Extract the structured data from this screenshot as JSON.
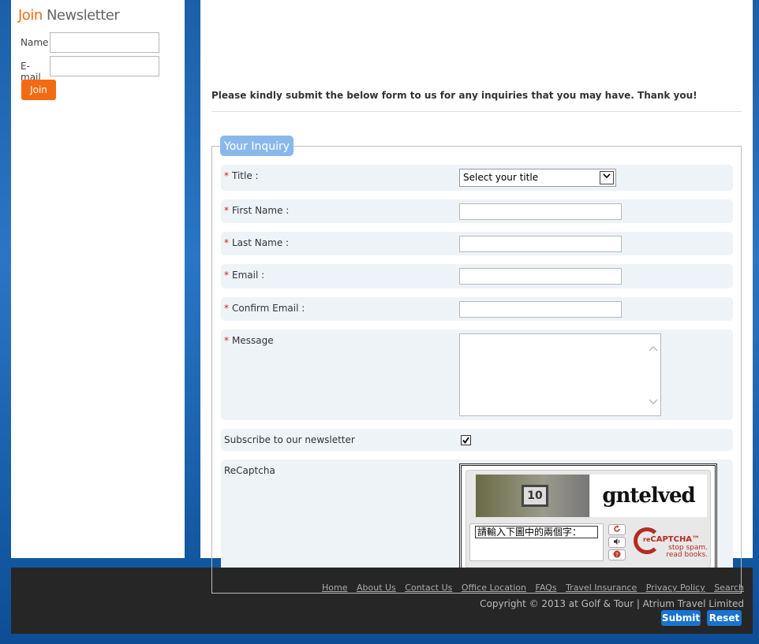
{
  "newsletter": {
    "title_accent": "Join",
    "title_rest": "Newsletter",
    "name_label": "Name",
    "email_label": "E-mail",
    "join_label": "Join"
  },
  "intro": "Please kindly submit the below form to us for any inquiries that you may have. Thank you!",
  "form": {
    "legend": "Your Inquiry",
    "required_mark": "*",
    "title_label": "Title :",
    "title_selected": "Select your title",
    "first_name_label": "First Name :",
    "last_name_label": "Last Name :",
    "email_label": "Email :",
    "confirm_email_label": "Confirm Email :",
    "message_label": "Message",
    "subscribe_label": "Subscribe to our newsletter",
    "subscribe_checked": true,
    "recaptcha_label": "ReCaptcha"
  },
  "recaptcha": {
    "image_number": "10",
    "image_word": "gntelved",
    "prompt": "請輸入下圖中的兩個字：",
    "brand_prefix": "re",
    "brand": "CAPTCHA™",
    "tagline1": "stop spam.",
    "tagline2": "read books."
  },
  "footer": {
    "links": [
      "Home",
      "About Us",
      "Contact Us",
      "Office Location",
      "FAQs",
      "Travel Insurance",
      "Privacy Policy",
      "Search"
    ],
    "copyright": "Copyright © 2013 at Golf & Tour | Atrium Travel Limited",
    "submit_label": "Submit",
    "reset_label": "Reset"
  },
  "colors": {
    "accent_orange": "#f26a12",
    "button_blue": "#1a73d0",
    "legend_blue": "#8ab8ea",
    "required_red": "#d42020"
  }
}
